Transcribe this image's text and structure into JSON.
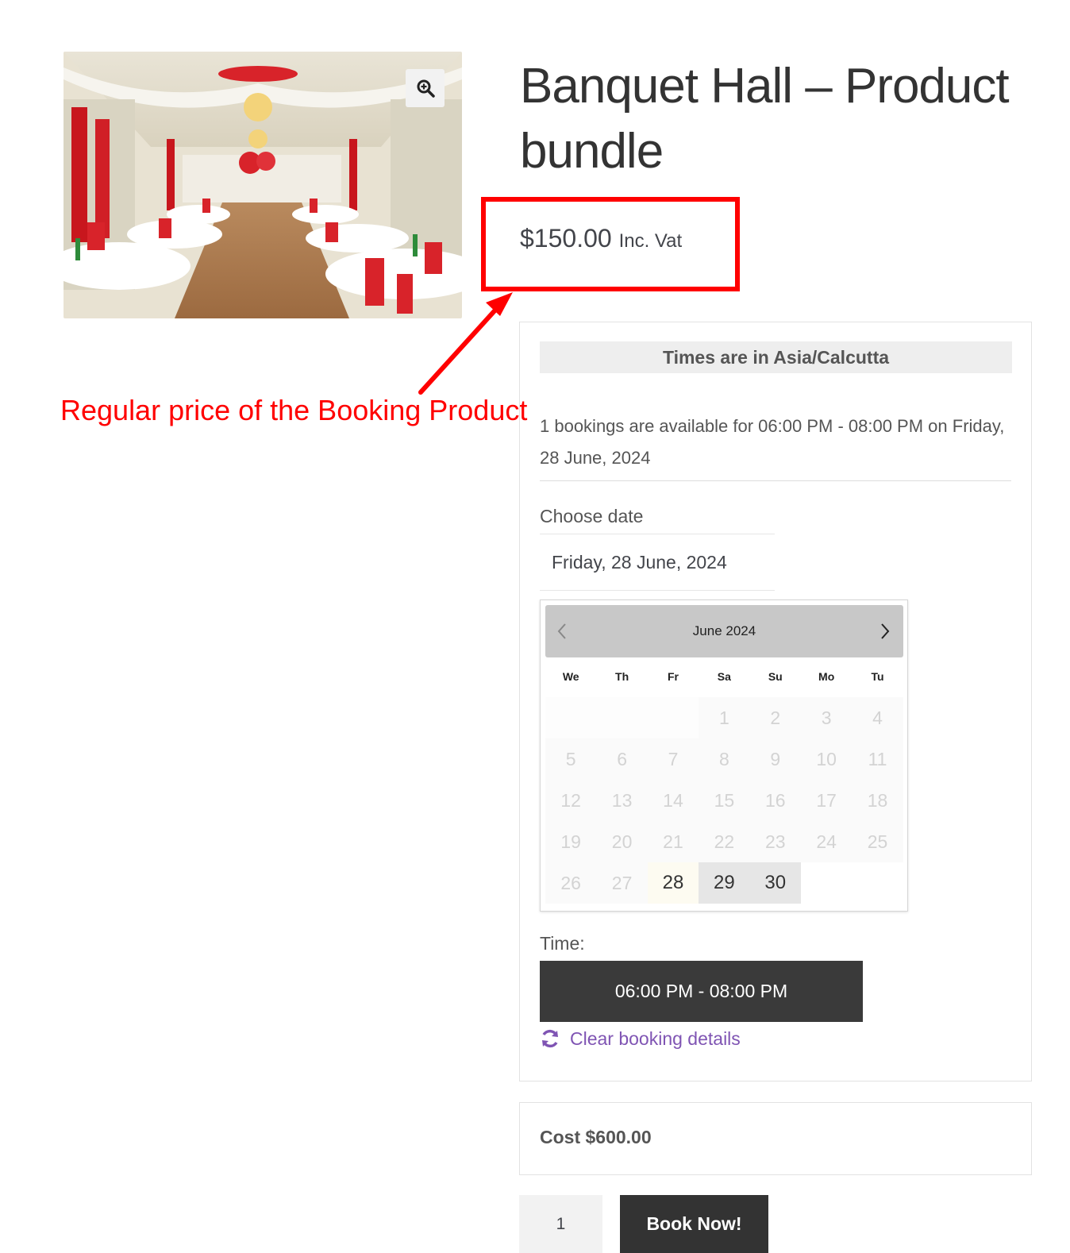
{
  "product": {
    "title": "Banquet Hall – Product bundle",
    "image_alt": "Banquet hall with red and white decorations"
  },
  "price": {
    "amount": "$150.00",
    "suffix": "Inc. Vat"
  },
  "annotation": {
    "text": "Regular price of the Booking Product",
    "color": "#ff0000"
  },
  "booking": {
    "timezone_banner": "Times are in Asia/Calcutta",
    "availability_text": "1 bookings are available for 06:00 PM - 08:00 PM on Friday, 28 June, 2024",
    "choose_date_label": "Choose date",
    "date_value": "Friday, 28 June, 2024",
    "calendar": {
      "month_title": "June 2024",
      "weekdays": [
        "We",
        "Th",
        "Fr",
        "Sa",
        "Su",
        "Mo",
        "Tu"
      ],
      "weeks": [
        [
          "",
          "",
          "",
          "1",
          "2",
          "3",
          "4"
        ],
        [
          "5",
          "6",
          "7",
          "8",
          "9",
          "10",
          "11"
        ],
        [
          "12",
          "13",
          "14",
          "15",
          "16",
          "17",
          "18"
        ],
        [
          "19",
          "20",
          "21",
          "22",
          "23",
          "24",
          "25"
        ],
        [
          "26",
          "27",
          "28",
          "29",
          "30",
          "",
          ""
        ]
      ],
      "selected_day": "28",
      "available_days": [
        "29",
        "30"
      ]
    },
    "time_label": "Time:",
    "time_slot": "06:00 PM - 08:00 PM",
    "clear_link": "Clear booking details",
    "accent_color": "#7f54b3"
  },
  "cost": {
    "text": "Cost $600.00"
  },
  "cart": {
    "quantity": "1",
    "book_button": "Book Now!"
  }
}
